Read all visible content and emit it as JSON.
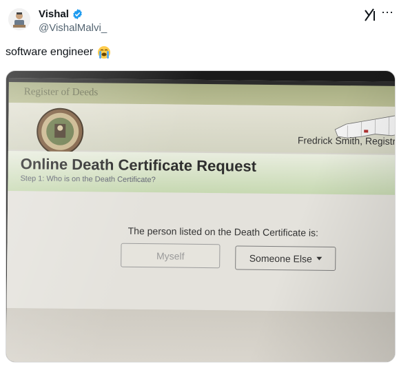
{
  "author": {
    "name": "Vishal",
    "handle": "@VishalMalvi_"
  },
  "tweet": {
    "text": "software engineer"
  },
  "icons": {
    "verified": "verified-badge-icon",
    "grok": "grok-icon",
    "more": "more-options-icon",
    "emoji": "loudly-crying-face-emoji"
  },
  "colors": {
    "verified_blue": "#1d9bf0",
    "handle_gray": "#536471"
  },
  "photo": {
    "topbar_title": "Register of Deeds",
    "registrar": "Fredrick Smith, Registra",
    "page_title": "Online Death Certificate Request",
    "step_text": "Step 1: Who is on the Death Certificate?",
    "question": "The person listed on the Death Certificate is:",
    "buttons": {
      "myself": "Myself",
      "someone_else": "Someone Else"
    }
  }
}
